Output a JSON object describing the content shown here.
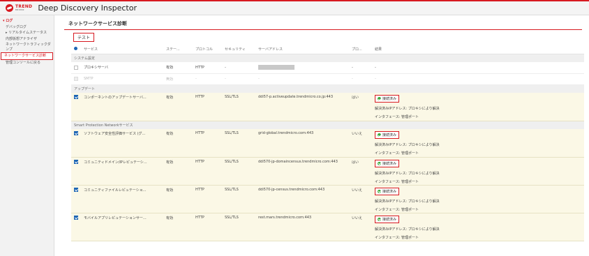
{
  "app": {
    "brand": "TREND",
    "brand_sub": "MICRO",
    "title": "Deep Discovery Inspector"
  },
  "sidebar": {
    "items": [
      {
        "label": "▾ ログ",
        "type": "head"
      },
      {
        "label": "デバッグログ",
        "type": "sub"
      },
      {
        "label": "▸ リアルタイムステータス",
        "type": "sub"
      },
      {
        "label": "内部仮想アナライザ",
        "type": "sub"
      },
      {
        "label": "ネットワークトラフィックダンプ",
        "type": "sub"
      },
      {
        "label": "ネットワークサービス診断",
        "type": "active"
      },
      {
        "label": "管理コンソールに戻る",
        "type": "sub"
      }
    ]
  },
  "page": {
    "title": "ネットワークサービス診断",
    "test_button": "テスト"
  },
  "table": {
    "headers": [
      "サービス",
      "ステー...",
      "プロトコル",
      "セキュリティ",
      "サーバアドレス",
      "プロ...",
      "結果"
    ],
    "sections": [
      {
        "name": "システム設定",
        "rows": [
          {
            "kind": "plain",
            "checkbox": "empty",
            "service": "プロキシサーバ",
            "status": "有効",
            "protocol": "HTTP",
            "security": "-",
            "server": "",
            "server_hidden": true,
            "proxy": "-",
            "result": "-"
          },
          {
            "kind": "plain disabled",
            "checkbox": "disabled",
            "service": "SMTP",
            "status": "無効",
            "protocol": "-",
            "security": "-",
            "server": "-",
            "proxy": "-",
            "result": "-"
          }
        ]
      },
      {
        "name": "アップデート",
        "rows": [
          {
            "kind": "sel",
            "checkbox": "checked",
            "service": "コンポーネントのアップデートサーバ...",
            "status": "有効",
            "protocol": "HTTP",
            "security": "SSL/TLS",
            "server": "ddi57-p.activeupdate.trendmicro.co.jp:443",
            "proxy": "はい",
            "result_badge": "接続済み",
            "result_line1": "解決済みIPアドレス: プロキシにより解決",
            "result_line2": "インタフェース: 管理ポート"
          }
        ]
      },
      {
        "name": "Smart Protection Networkサービス",
        "rows": [
          {
            "kind": "sel",
            "checkbox": "checked",
            "service": "ソフトウェア安全性評価サービス (グ...",
            "status": "有効",
            "protocol": "HTTP",
            "security": "SSL/TLS",
            "server": "grid-global.trendmicro.com:443",
            "proxy": "いいえ",
            "result_badge": "接続済み",
            "result_line1": "解決済みIPアドレス: プロキシにより解決",
            "result_line2": "インタフェース: 管理ポート"
          },
          {
            "kind": "sel",
            "checkbox": "checked",
            "service": "コミュニティドメイン/IPレピュテーシ...",
            "status": "有効",
            "protocol": "HTTP",
            "security": "SSL/TLS",
            "server": "ddi570-jp-domaincensus.trendmicro.com:443",
            "proxy": "はい",
            "result_badge": "接続済み",
            "result_line1": "解決済みIPアドレス: プロキシにより解決",
            "result_line2": "インタフェース: 管理ポート"
          },
          {
            "kind": "sel",
            "checkbox": "checked",
            "service": "コミュニティファイルレピュテーショ...",
            "status": "有効",
            "protocol": "HTTP",
            "security": "SSL/TLS",
            "server": "ddi570-jp-census.trendmicro.com:443",
            "proxy": "いいえ",
            "result_badge": "接続済み",
            "result_line1": "解決済みIPアドレス: プロキシにより解決",
            "result_line2": "インタフェース: 管理ポート"
          },
          {
            "kind": "sel",
            "checkbox": "checked",
            "service": "モバイルアプリレピュテーションサー...",
            "status": "有効",
            "protocol": "HTTP",
            "security": "SSL/TLS",
            "server": "rest.mars.trendmicro.com:443",
            "proxy": "いいえ",
            "result_badge": "接続済み",
            "result_line1": "解決済みIPアドレス: プロキシにより解決",
            "result_line2": "インタフェース: 管理ポート"
          }
        ]
      }
    ]
  },
  "colors": {
    "accent": "#d71920",
    "checkbox": "#1e66b4",
    "selected_row": "#fbf8e6",
    "ok": "#3aa83a"
  }
}
